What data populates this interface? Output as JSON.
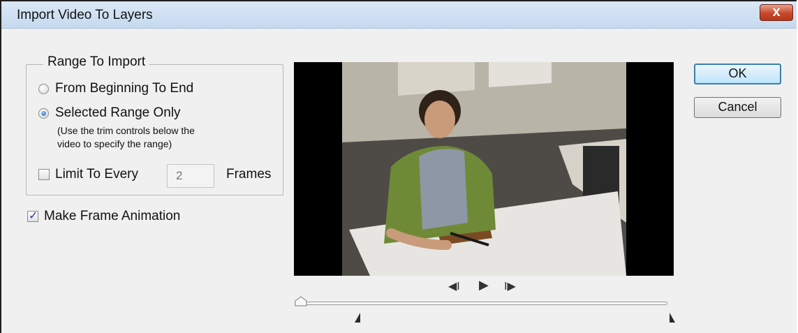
{
  "window": {
    "title": "Import Video To Layers",
    "close_label": "x"
  },
  "range": {
    "title": "Range To Import",
    "option_all": "From Beginning To End",
    "option_selected": "Selected Range Only",
    "hint_line1": "(Use the trim controls below the",
    "hint_line2": "video to specify the range)",
    "selected": "Selected Range Only"
  },
  "limit": {
    "label": "Limit To Every",
    "checked": false,
    "value": "2",
    "unit": "Frames"
  },
  "animation": {
    "label": "Make Frame Animation",
    "checked": true
  },
  "buttons": {
    "ok": "OK",
    "cancel": "Cancel"
  },
  "playback": {
    "prev_frame": "◀I",
    "play": "▶",
    "next_frame": "I▶"
  },
  "colors": {
    "title_bar": "#c9dcf0",
    "close_button": "#c6492b",
    "default_button_border": "#3c7fb1"
  },
  "icons": [
    "close-icon",
    "radio-icon",
    "checkbox-icon",
    "prev-frame-icon",
    "play-icon",
    "next-frame-icon",
    "trim-marker-icon"
  ]
}
